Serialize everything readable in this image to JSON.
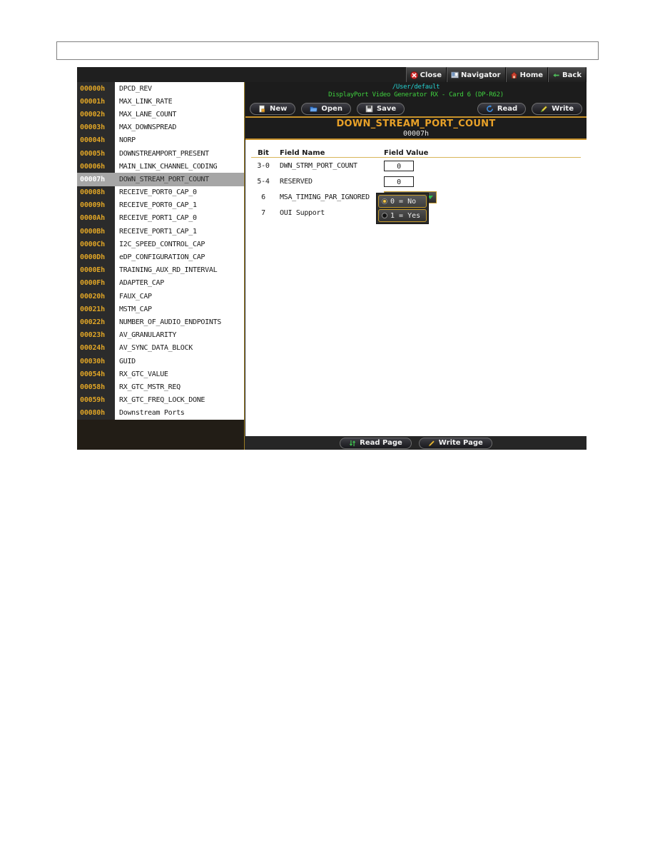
{
  "titlebar": {
    "buttons": [
      {
        "label": "Close",
        "icon": "close-icon"
      },
      {
        "label": "Navigator",
        "icon": "navigator-icon"
      },
      {
        "label": "Home",
        "icon": "home-icon"
      },
      {
        "label": "Back",
        "icon": "back-arrow-icon"
      }
    ]
  },
  "registers": [
    {
      "addr": "00000h",
      "name": "DPCD_REV"
    },
    {
      "addr": "00001h",
      "name": "MAX_LINK_RATE"
    },
    {
      "addr": "00002h",
      "name": "MAX_LANE_COUNT"
    },
    {
      "addr": "00003h",
      "name": "MAX_DOWNSPREAD"
    },
    {
      "addr": "00004h",
      "name": "NORP"
    },
    {
      "addr": "00005h",
      "name": "DOWNSTREAMPORT_PRESENT"
    },
    {
      "addr": "00006h",
      "name": "MAIN_LINK_CHANNEL_CODING"
    },
    {
      "addr": "00007h",
      "name": "DOWN_STREAM_PORT_COUNT"
    },
    {
      "addr": "00008h",
      "name": "RECEIVE_PORT0_CAP_0"
    },
    {
      "addr": "00009h",
      "name": "RECEIVE_PORT0_CAP_1"
    },
    {
      "addr": "0000Ah",
      "name": "RECEIVE_PORT1_CAP_0"
    },
    {
      "addr": "0000Bh",
      "name": "RECEIVE_PORT1_CAP_1"
    },
    {
      "addr": "0000Ch",
      "name": "I2C_SPEED_CONTROL_CAP"
    },
    {
      "addr": "0000Dh",
      "name": "eDP_CONFIGURATION_CAP"
    },
    {
      "addr": "0000Eh",
      "name": "TRAINING_AUX_RD_INTERVAL"
    },
    {
      "addr": "0000Fh",
      "name": "ADAPTER_CAP"
    },
    {
      "addr": "00020h",
      "name": "FAUX_CAP"
    },
    {
      "addr": "00021h",
      "name": "MSTM_CAP"
    },
    {
      "addr": "00022h",
      "name": "NUMBER_OF_AUDIO_ENDPOINTS"
    },
    {
      "addr": "00023h",
      "name": "AV_GRANULARITY"
    },
    {
      "addr": "00024h",
      "name": "AV_SYNC_DATA_BLOCK"
    },
    {
      "addr": "00030h",
      "name": "GUID"
    },
    {
      "addr": "00054h",
      "name": "RX_GTC_VALUE"
    },
    {
      "addr": "00058h",
      "name": "RX_GTC_MSTR_REQ"
    },
    {
      "addr": "00059h",
      "name": "RX_GTC_FREQ_LOCK_DONE"
    },
    {
      "addr": "00080h",
      "name": "Downstream Ports"
    }
  ],
  "selected_register_index": 7,
  "path": {
    "user_path": "/User/default",
    "device": "DisplayPort Video Generator RX - Card 6   (DP-R62)"
  },
  "file_bar": {
    "new_label": "New",
    "open_label": "Open",
    "save_label": "Save",
    "read_label": "Read",
    "write_label": "Write"
  },
  "register_detail": {
    "title": "DOWN_STREAM_PORT_COUNT",
    "address": "00007h",
    "columns": {
      "bit": "Bit",
      "field_name": "Field Name",
      "field_value": "Field Value"
    },
    "fields": [
      {
        "bit": "3-0",
        "name": "DWN_STRM_PORT_COUNT",
        "control": "text",
        "value": "0"
      },
      {
        "bit": "5-4",
        "name": "RESERVED",
        "control": "text",
        "value": "0"
      },
      {
        "bit": "6",
        "name": "MSA_TIMING_PAR_IGNORED",
        "control": "combo",
        "value": "0 = No"
      },
      {
        "bit": "7",
        "name": "OUI Support",
        "control": "none",
        "value": ""
      }
    ],
    "combo_options": [
      {
        "label": "0 = No",
        "selected": true
      },
      {
        "label": "1 = Yes",
        "selected": false
      }
    ]
  },
  "footer": {
    "read_page_label": "Read Page",
    "write_page_label": "Write Page"
  },
  "colors": {
    "accent_gold": "#e8a128",
    "rule_gold": "#c8922a",
    "cyan_path": "#25d0d0",
    "green_device": "#3fd13f",
    "window_bg": "#262626",
    "panel_white": "#ffffff"
  }
}
